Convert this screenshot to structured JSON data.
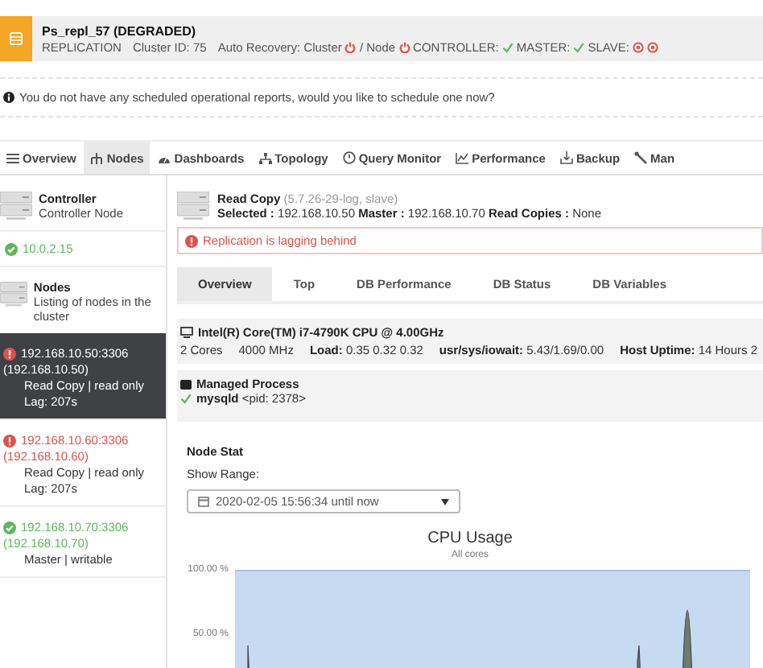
{
  "cluster": {
    "name": "Ps_repl_57 (DEGRADED)",
    "type": "REPLICATION",
    "cluster_id": "Cluster ID: 75",
    "statuses": [
      {
        "label": "Auto Recovery: Cluster",
        "indicators": [
          {
            "kind": "power"
          }
        ]
      },
      {
        "label": "/ Node",
        "indicators": [
          {
            "kind": "power"
          }
        ]
      },
      {
        "label": "CONTROLLER:",
        "indicators": [
          {
            "kind": "check"
          }
        ]
      },
      {
        "label": "MASTER:",
        "indicators": [
          {
            "kind": "check"
          }
        ]
      },
      {
        "label": "SLAVE:",
        "indicators": [
          {
            "kind": "alert"
          },
          {
            "kind": "alert"
          }
        ]
      }
    ]
  },
  "notice": "You do not have any scheduled operational reports, would you like to schedule one now?",
  "tabs": [
    {
      "label": "Overview",
      "selected": false
    },
    {
      "label": "Nodes",
      "selected": true
    },
    {
      "label": "Dashboards",
      "selected": false
    },
    {
      "label": "Topology",
      "selected": false
    },
    {
      "label": "Query Monitor",
      "selected": false
    },
    {
      "label": "Performance",
      "selected": false
    },
    {
      "label": "Backup",
      "selected": false
    },
    {
      "label": "Man",
      "selected": false
    }
  ],
  "sidebar": {
    "controller": {
      "title": "Controller",
      "subtitle": "Controller Node",
      "address": "10.0.2.15",
      "healthy": true
    },
    "nodes_header": {
      "title": "Nodes",
      "subtitle": "Listing of nodes in the cluster"
    },
    "nodes": [
      {
        "address": "192.168.10.50:3306",
        "host": "(192.168.10.50)",
        "role": "Read Copy | read only",
        "lag": "Lag: 207s",
        "healthy": false,
        "selected": true
      },
      {
        "address": "192.168.10.60:3306",
        "host": "(192.168.10.60)",
        "role": "Read Copy | read only",
        "lag": "Lag: 207s",
        "healthy": false,
        "selected": false
      },
      {
        "address": "192.168.10.70:3306",
        "host": "(192.168.10.70)",
        "role": "Master | writable",
        "healthy": true,
        "selected": false
      }
    ]
  },
  "detail": {
    "title": "Read Copy",
    "version": "(5.7.26-29-log, slave)",
    "summary": "**Selected :** 192.168.10.50 **Master :** 192.168.10.70 **Read Copies :** None",
    "alert": "Replication is lagging behind",
    "tabs": [
      {
        "label": "Overview",
        "selected": true
      },
      {
        "label": "Top",
        "selected": false
      },
      {
        "label": "DB Performance",
        "selected": false
      },
      {
        "label": "DB Status",
        "selected": false
      },
      {
        "label": "DB Variables",
        "selected": false
      }
    ],
    "cpu": {
      "title": "Intel(R) Core(TM) i7-4790K CPU @ 4.00GHz",
      "stats": [
        "2 Cores",
        "4000 MHz",
        "**Load:** 0.35 0.32 0.32",
        "**usr/sys/iowait:** 5.43/1.69/0.00",
        "**Host Uptime:** 14 Hours 2"
      ]
    },
    "process": {
      "title": "Managed Process",
      "name": "**mysqld** <pid: 2378>",
      "running": true
    },
    "node_stat": {
      "title": "Node Stat",
      "range_label": "Show Range:",
      "range_value": "2020-02-05 15:56:34 until now",
      "chart": {
        "title": "CPU Usage",
        "subtitle": "All cores",
        "y_labels": [
          "100.00 %",
          "50.00 %"
        ]
      }
    }
  }
}
